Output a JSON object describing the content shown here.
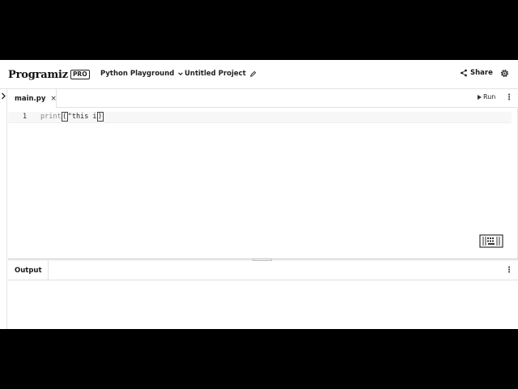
{
  "header": {
    "logo_text": "Programiz",
    "logo_badge": "PRO",
    "menu_playground": "Python Playground",
    "project_name": "Untitled Project",
    "share_label": "Share"
  },
  "editor": {
    "file_tab": "main.py",
    "close_glyph": "×",
    "run_label": "Run",
    "kebab": "⋮",
    "line_number": "1",
    "code_keyword": "print",
    "code_open_paren": "(",
    "code_string": "\"this i",
    "code_close_paren": ")"
  },
  "output": {
    "tab_label": "Output",
    "kebab": "⋮"
  },
  "icons": {
    "chevron": "chevron-down-icon",
    "pencil": "pencil-icon",
    "share": "share-icon",
    "gear": "gear-icon",
    "sidebar": "chevron-right-icon",
    "keyboard": "keyboard-icon",
    "play": "play-icon"
  }
}
